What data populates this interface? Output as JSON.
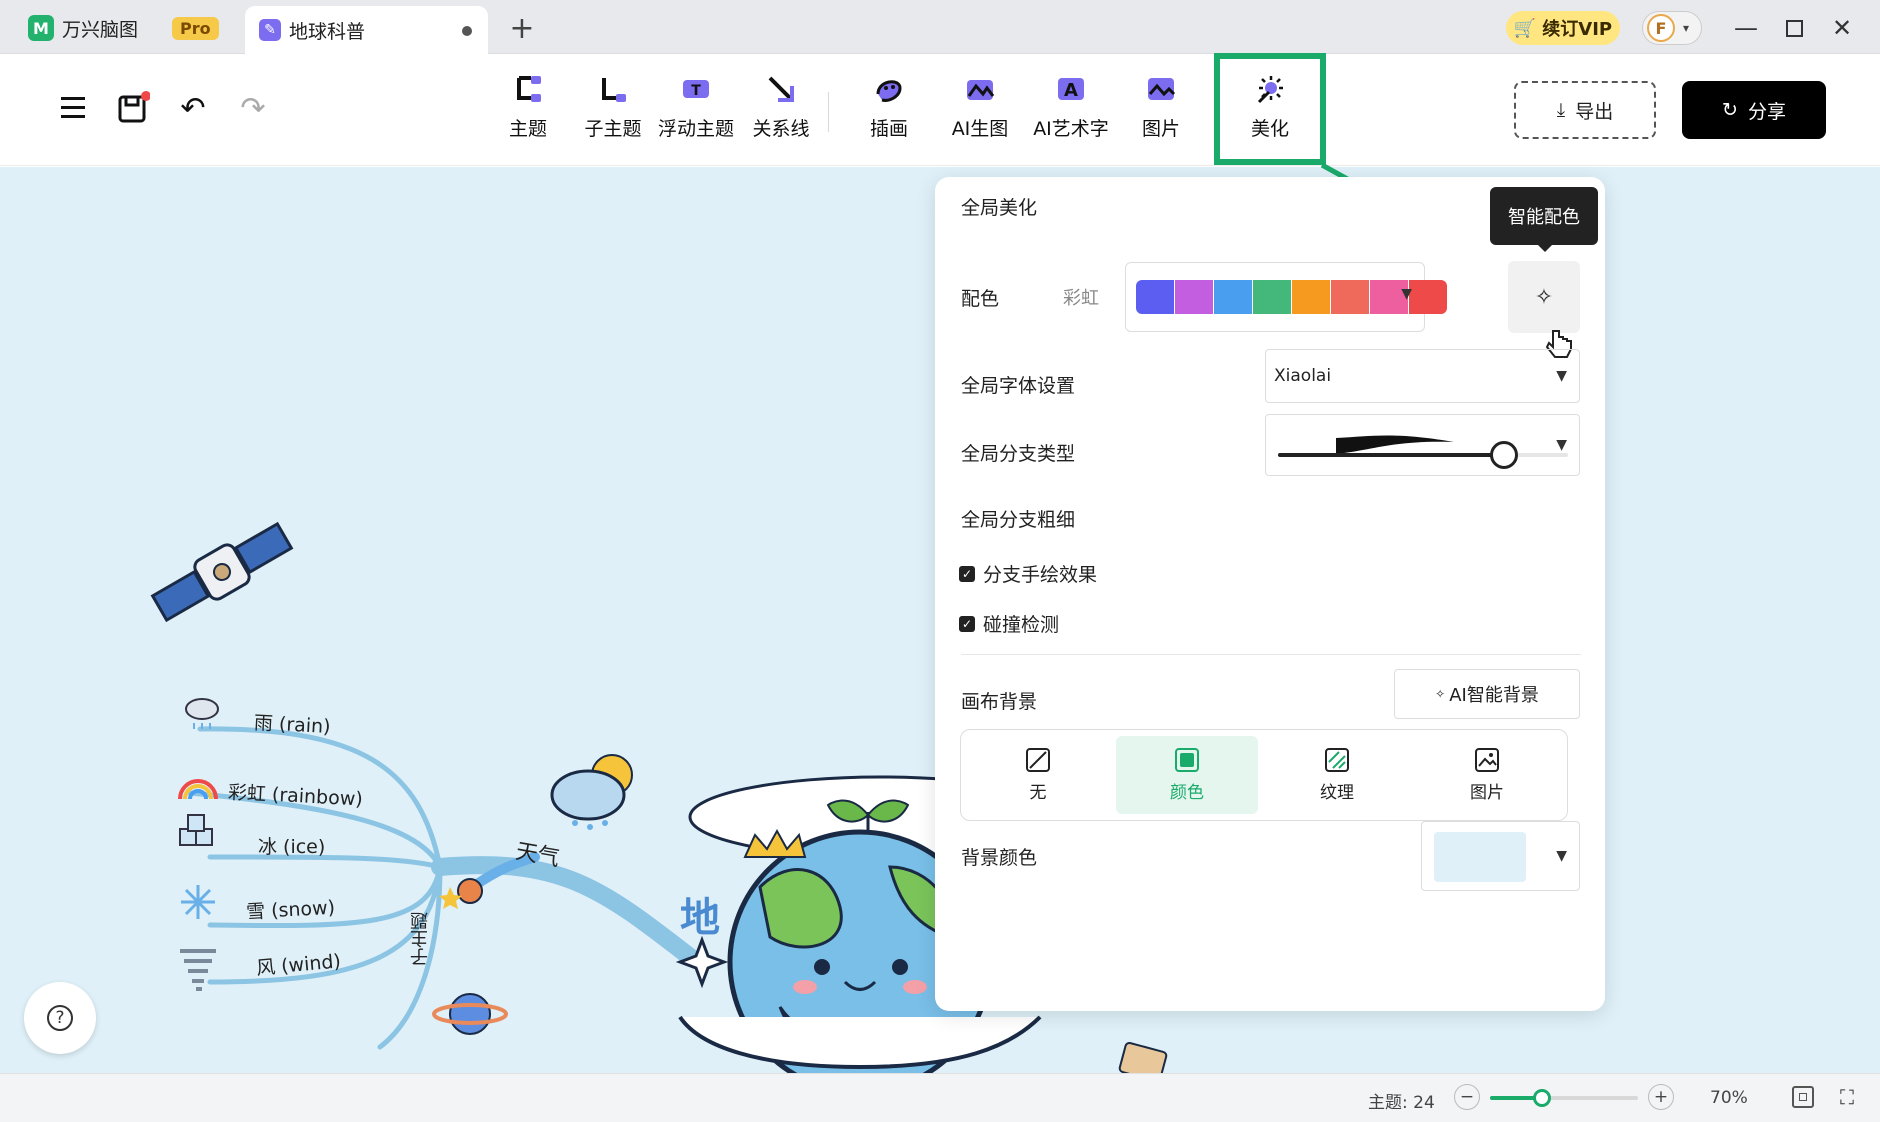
{
  "titlebar": {
    "app_name": "万兴脑图",
    "app_logo": "M",
    "pro_badge": "Pro",
    "doc_tab": "地球科普",
    "vip_label": "续订VIP",
    "avatar_letter": "F"
  },
  "toolbar": {
    "tools": [
      {
        "label": "主题",
        "icon": "topic-icon"
      },
      {
        "label": "子主题",
        "icon": "subtopic-icon"
      },
      {
        "label": "浮动主题",
        "icon": "floating-topic-icon"
      },
      {
        "label": "关系线",
        "icon": "relation-line-icon"
      },
      {
        "label": "插画",
        "icon": "illustration-icon"
      },
      {
        "label": "AI生图",
        "icon": "ai-image-icon"
      },
      {
        "label": "AI艺术字",
        "icon": "ai-art-text-icon"
      },
      {
        "label": "图片",
        "icon": "picture-icon"
      },
      {
        "label": "美化",
        "icon": "beautify-icon"
      }
    ],
    "export_label": "导出",
    "share_label": "分享"
  },
  "canvas": {
    "background_color": "#dff0f8",
    "branches": [
      {
        "label": "雨 (rain)"
      },
      {
        "label": "彩虹 (rainbow)"
      },
      {
        "label": "冰 (ice)"
      },
      {
        "label": "雪 (snow)"
      },
      {
        "label": "风 (wind)"
      }
    ],
    "branch_group": "天气",
    "vertical_subtopic": "子主题",
    "partial_title": "地"
  },
  "panel": {
    "title": "全局美化",
    "color_scheme": {
      "label": "配色",
      "name": "彩虹",
      "colors": [
        "#5b5ef0",
        "#c45ee0",
        "#4a9ef0",
        "#43b87a",
        "#f59a1e",
        "#ef6a5a",
        "#ee5fa0",
        "#ee4a4a"
      ],
      "tooltip": "智能配色"
    },
    "font": {
      "label": "全局字体设置",
      "value": "Xiaolai"
    },
    "branch_type": {
      "label": "全局分支类型"
    },
    "branch_width": {
      "label": "全局分支粗细",
      "level": 0.78
    },
    "hand_drawn": {
      "label": "分支手绘效果",
      "checked": true
    },
    "collision": {
      "label": "碰撞检测",
      "checked": true
    },
    "canvas_bg": {
      "label": "画布背景",
      "ai_button": "AI智能背景",
      "options": [
        {
          "label": "无"
        },
        {
          "label": "颜色"
        },
        {
          "label": "纹理"
        },
        {
          "label": "图片"
        }
      ],
      "active_option": "颜色"
    },
    "bg_color": {
      "label": "背景颜色",
      "value": "#dff0f8"
    }
  },
  "statusbar": {
    "topic_count": "主题: 24",
    "zoom_level": "70%",
    "zoom_slider_level": 0.35
  },
  "colors": {
    "accent": "#1aaa6a",
    "branch": "#8cc4e4"
  }
}
